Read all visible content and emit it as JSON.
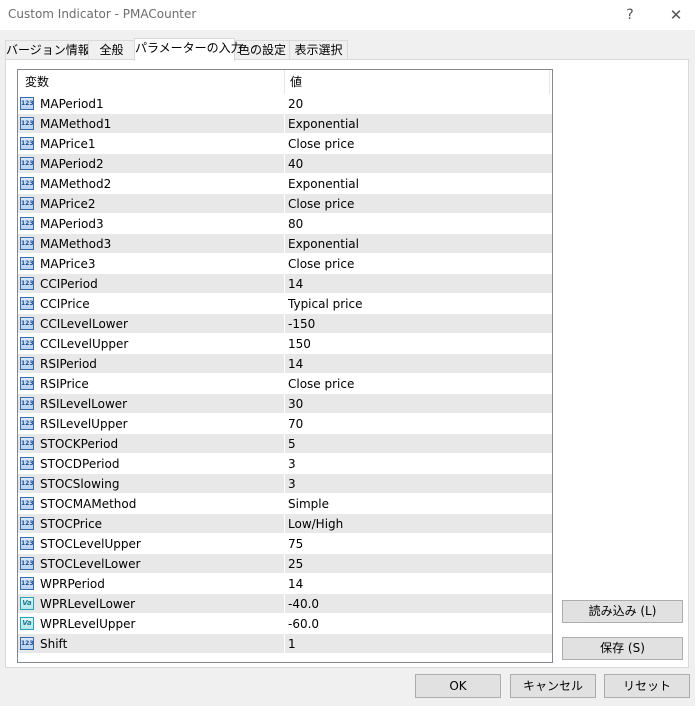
{
  "window": {
    "title": "Custom Indicator - PMACounter",
    "help_glyph": "?",
    "close_glyph": "✕"
  },
  "tabs": [
    {
      "label": "バージョン情報",
      "active": false
    },
    {
      "label": "全般",
      "active": false
    },
    {
      "label": "パラメーターの入力",
      "active": true
    },
    {
      "label": "色の設定",
      "active": false
    },
    {
      "label": "表示選択",
      "active": false
    }
  ],
  "grid": {
    "col_variable": "変数",
    "col_value": "値",
    "rows": [
      {
        "name": "MAPeriod1",
        "value": "20",
        "icon": "123"
      },
      {
        "name": "MAMethod1",
        "value": "Exponential",
        "icon": "123"
      },
      {
        "name": "MAPrice1",
        "value": "Close price",
        "icon": "123"
      },
      {
        "name": "MAPeriod2",
        "value": "40",
        "icon": "123"
      },
      {
        "name": "MAMethod2",
        "value": "Exponential",
        "icon": "123"
      },
      {
        "name": "MAPrice2",
        "value": "Close price",
        "icon": "123"
      },
      {
        "name": "MAPeriod3",
        "value": "80",
        "icon": "123"
      },
      {
        "name": "MAMethod3",
        "value": "Exponential",
        "icon": "123"
      },
      {
        "name": "MAPrice3",
        "value": "Close price",
        "icon": "123"
      },
      {
        "name": "CCIPeriod",
        "value": "14",
        "icon": "123"
      },
      {
        "name": "CCIPrice",
        "value": "Typical price",
        "icon": "123"
      },
      {
        "name": "CCILevelLower",
        "value": "-150",
        "icon": "123"
      },
      {
        "name": "CCILevelUpper",
        "value": "150",
        "icon": "123"
      },
      {
        "name": "RSIPeriod",
        "value": "14",
        "icon": "123"
      },
      {
        "name": "RSIPrice",
        "value": "Close price",
        "icon": "123"
      },
      {
        "name": "RSILevelLower",
        "value": "30",
        "icon": "123"
      },
      {
        "name": "RSILevelUpper",
        "value": "70",
        "icon": "123"
      },
      {
        "name": "STOCKPeriod",
        "value": "5",
        "icon": "123"
      },
      {
        "name": "STOCDPeriod",
        "value": "3",
        "icon": "123"
      },
      {
        "name": "STOCSlowing",
        "value": "3",
        "icon": "123"
      },
      {
        "name": "STOCMAMethod",
        "value": "Simple",
        "icon": "123"
      },
      {
        "name": "STOCPrice",
        "value": "Low/High",
        "icon": "123"
      },
      {
        "name": "STOCLevelUpper",
        "value": "75",
        "icon": "123"
      },
      {
        "name": "STOCLevelLower",
        "value": "25",
        "icon": "123"
      },
      {
        "name": "WPRPeriod",
        "value": "14",
        "icon": "123"
      },
      {
        "name": "WPRLevelLower",
        "value": "-40.0",
        "icon": "Va"
      },
      {
        "name": "WPRLevelUpper",
        "value": "-60.0",
        "icon": "Va"
      },
      {
        "name": "Shift",
        "value": "1",
        "icon": "123"
      }
    ]
  },
  "buttons": {
    "load": "読み込み (L)",
    "save": "保存 (S)",
    "ok": "OK",
    "cancel": "キャンセル",
    "reset": "リセット"
  },
  "colors": {
    "row_alt": "#e8e8e8",
    "window_bg": "#f0f0f0",
    "button_bg": "#e1e1e1"
  }
}
